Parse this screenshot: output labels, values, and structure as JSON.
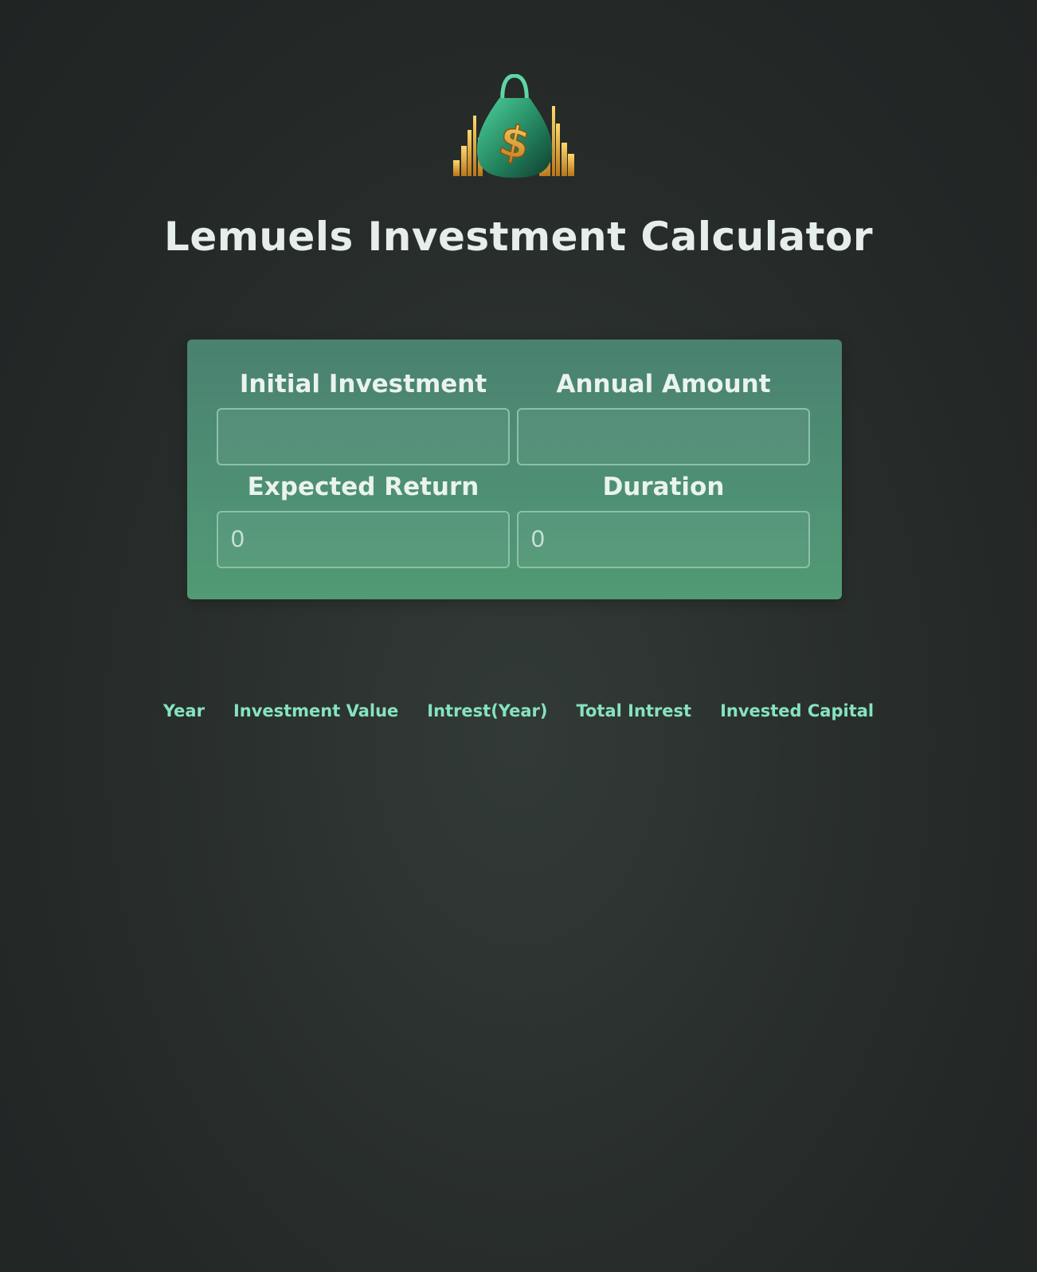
{
  "header": {
    "logo_icon": "money-bag-dollar-icon",
    "title": "Lemuels Investment Calculator"
  },
  "form": {
    "initial_investment": {
      "label": "Initial Investment",
      "value": ""
    },
    "annual_amount": {
      "label": "Annual Amount",
      "value": ""
    },
    "expected_return": {
      "label": "Expected Return",
      "value": "0"
    },
    "duration": {
      "label": "Duration",
      "value": "0"
    }
  },
  "results_table": {
    "columns": [
      "Year",
      "Investment Value",
      "Intrest(Year)",
      "Total Intrest",
      "Invested Capital"
    ],
    "rows": []
  },
  "colors": {
    "background": "#262b29",
    "card": "#4e8c72",
    "header_text": "#86e3bf",
    "title_text": "#e6eeea"
  }
}
